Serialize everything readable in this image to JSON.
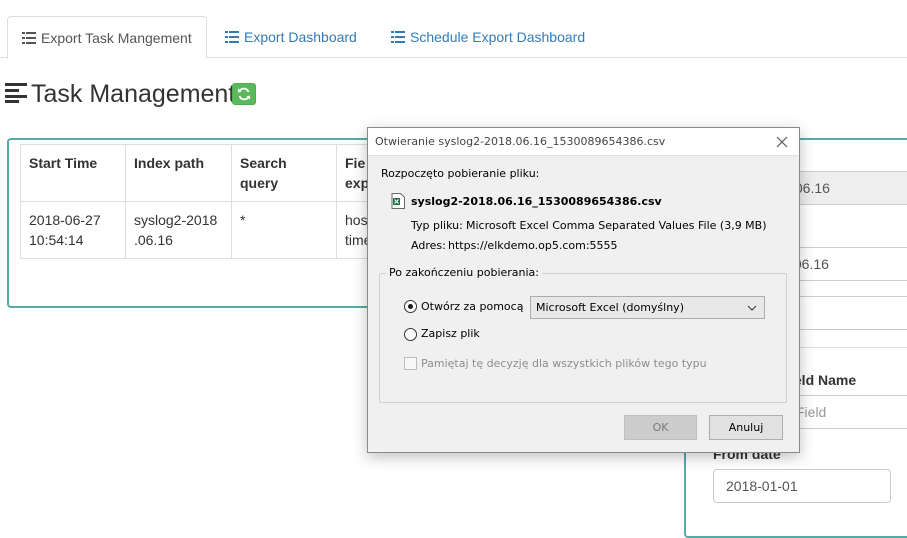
{
  "tabs": [
    {
      "label": "Export Task Mangement",
      "icon": "list-icon",
      "active": true
    },
    {
      "label": "Export Dashboard",
      "icon": "list-icon",
      "active": false
    },
    {
      "label": "Schedule Export Dashboard",
      "icon": "list-icon",
      "active": false
    }
  ],
  "page": {
    "title": "Task Management",
    "title_icon": "align-left-icon",
    "refresh_icon": "refresh-icon",
    "refresh_color": "#5cb85c",
    "panel_border_color": "#58aaa7"
  },
  "table": {
    "headers": [
      "Start Time",
      "Index path",
      "Search query",
      "Fie exp"
    ],
    "header_lines": [
      [
        "Start Time"
      ],
      [
        "Index path"
      ],
      [
        "Search",
        "query"
      ],
      [
        "Fie",
        "exp"
      ]
    ],
    "rows": [
      {
        "start_time": [
          "2018-06-27",
          "10:54:14"
        ],
        "index_path": [
          "syslog2-2018",
          ".06.16"
        ],
        "search_query": "*",
        "fields": [
          "hos",
          "time"
        ]
      }
    ]
  },
  "right_form": {
    "label_partial": "n",
    "input1_value": ".06.16",
    "input2_value": ".06.16",
    "field_name_label": "ield Name",
    "field_placeholder": "Field",
    "from_date_label": "From date",
    "from_date_value": "2018-01-01"
  },
  "dialog": {
    "title": "Otwieranie syslog2-2018.06.16_1530089654386.csv",
    "intro": "Rozpoczęto pobieranie pliku:",
    "file_name": "syslog2-2018.06.16_1530089654386.csv",
    "file_icon": "excel-file-icon",
    "type_label": "Typ pliku:",
    "type_value": "Microsoft Excel Comma Separated Values File (3,9 MB)",
    "address_label": "Adres:",
    "address_value": "https://elkdemo.op5.com:5555",
    "group_label": "Po zakończeniu pobierania:",
    "open_with_label": "Otwórz za pomocą",
    "open_with_selected": true,
    "open_with_app": "Microsoft Excel (domyślny)",
    "save_label": "Zapisz plik",
    "save_selected": false,
    "remember_label": "Pamiętaj tę decyzję dla wszystkich plików tego typu",
    "remember_checked": false,
    "ok_label": "OK",
    "cancel_label": "Anuluj"
  }
}
